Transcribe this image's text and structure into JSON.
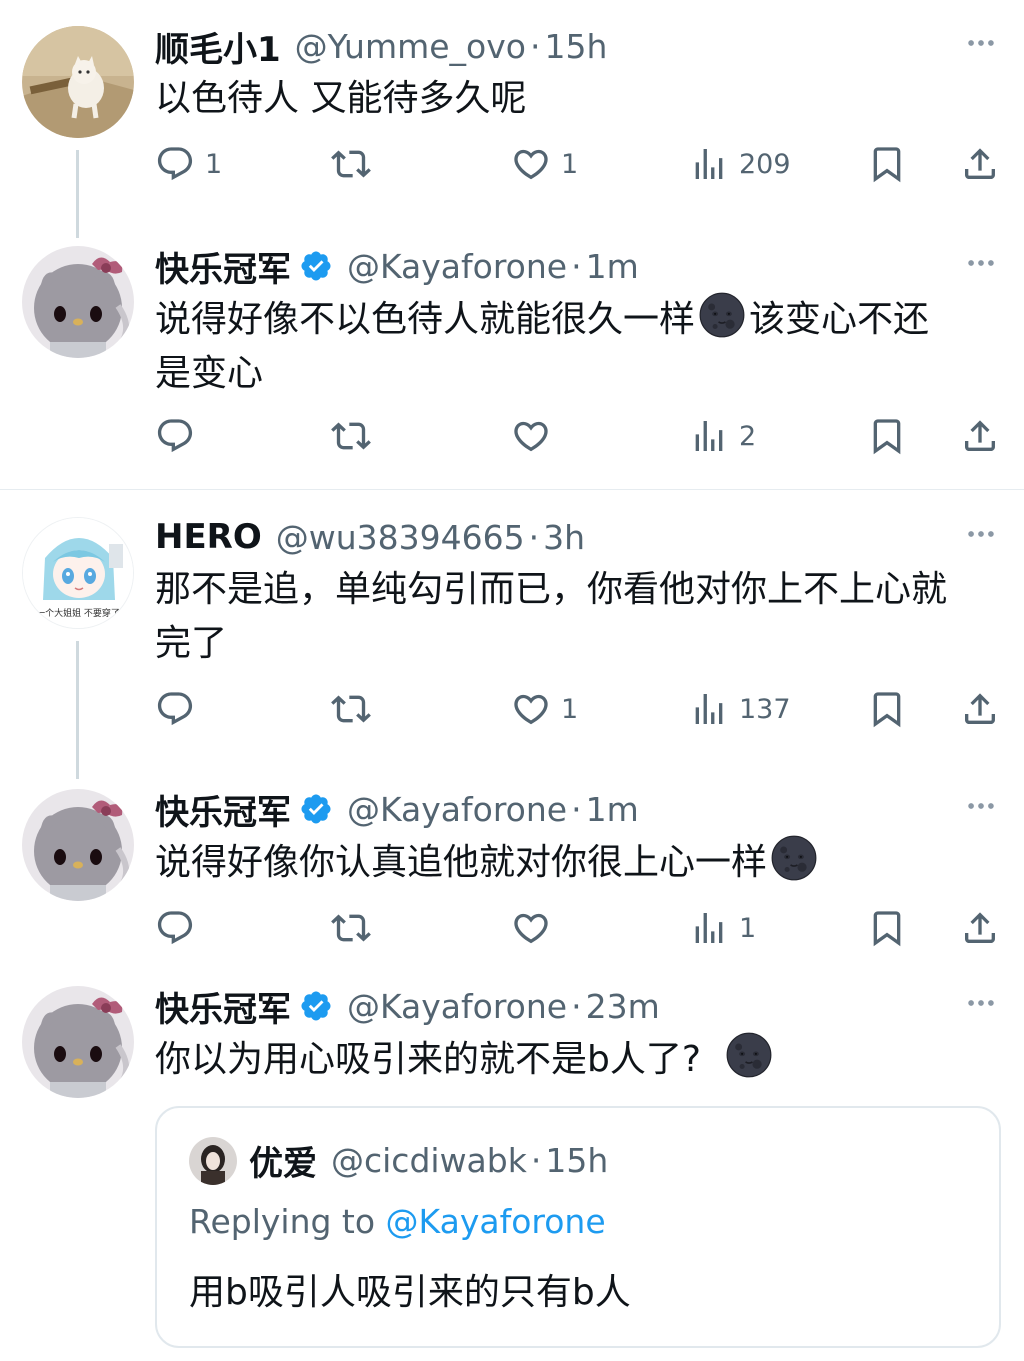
{
  "colors": {
    "accent": "#1d9bf0",
    "secondary_text": "#536471",
    "primary_text": "#0f1419"
  },
  "tweets": [
    {
      "name": "顺毛小1",
      "handle": "@Yumme_ovo",
      "time": "15h",
      "verified": false,
      "avatar": "cat-photo",
      "text": "以色待人 又能待多久呢",
      "replies": "1",
      "retweets": "",
      "likes": "1",
      "views": "209"
    },
    {
      "name": "快乐冠军",
      "handle": "@Kayaforone",
      "time": "1m",
      "verified": true,
      "avatar": "hello-kitty",
      "text": "说得好像不以色待人就能很久一样",
      "text_tail": "该变心不还",
      "text_line2": "是变心",
      "replies": "",
      "retweets": "",
      "likes": "",
      "views": "2"
    },
    {
      "name": "HERO",
      "handle": "@wu38394665",
      "time": "3h",
      "verified": false,
      "avatar": "anime-girl",
      "avatar_caption": "一个大姐姐 不要穿了",
      "text": "那不是追，单纯勾引而已，你看他对你上不上心就",
      "text_line2": "完了",
      "replies": "",
      "retweets": "",
      "likes": "1",
      "views": "137"
    },
    {
      "name": "快乐冠军",
      "handle": "@Kayaforone",
      "time": "1m",
      "verified": true,
      "avatar": "hello-kitty",
      "text": "说得好像你认真追他就对你很上心一样",
      "replies": "",
      "retweets": "",
      "likes": "",
      "views": "1"
    },
    {
      "name": "快乐冠军",
      "handle": "@Kayaforone",
      "time": "23m",
      "verified": true,
      "avatar": "hello-kitty",
      "text": "你以为用心吸引来的就不是b人了?",
      "quote": {
        "name": "优爱",
        "handle": "@cicdiwabk",
        "time": "15h",
        "replying_to_label": "Replying to",
        "replying_to_handle": "@Kayaforone",
        "text": "用b吸引人吸引来的只有b人"
      }
    }
  ],
  "separator": "·",
  "icons": [
    "reply-icon",
    "retweet-icon",
    "like-icon",
    "views-icon",
    "bookmark-icon",
    "share-icon",
    "more-icon",
    "verified-badge-icon",
    "new-moon-face-emoji"
  ]
}
